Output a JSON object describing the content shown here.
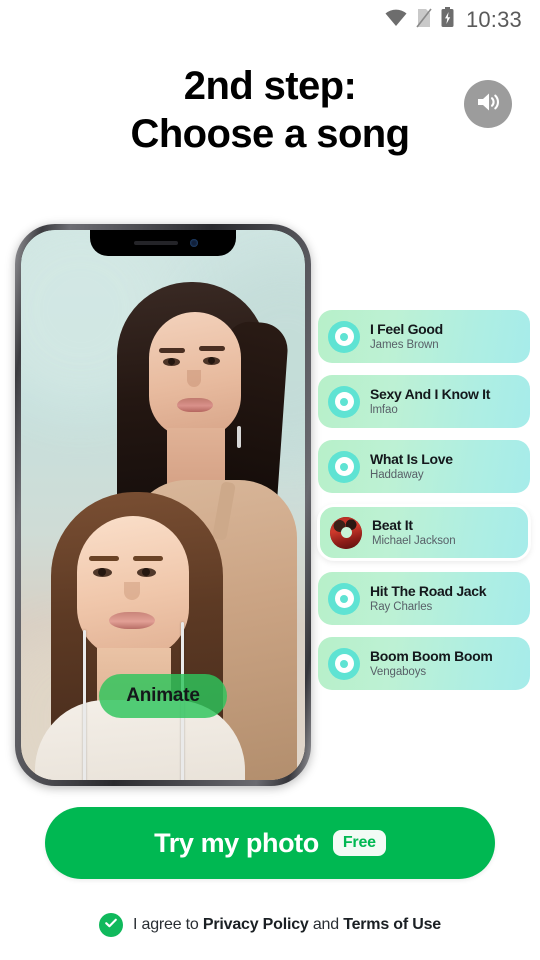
{
  "status_bar": {
    "time": "10:33",
    "icons": [
      "wifi-icon",
      "sim-card-off-icon",
      "battery-charging-icon"
    ]
  },
  "header": {
    "title_line1": "2nd step:",
    "title_line2": "Choose a song",
    "sound_button_icon": "speaker-volume-icon"
  },
  "preview": {
    "animate_button_label": "Animate"
  },
  "songs": [
    {
      "title": "I Feel Good",
      "artist": "James Brown",
      "selected": false,
      "icon": "vinyl-disc-icon"
    },
    {
      "title": "Sexy And I Know It",
      "artist": "lmfao",
      "selected": false,
      "icon": "vinyl-disc-icon"
    },
    {
      "title": "What Is Love",
      "artist": "Haddaway",
      "selected": false,
      "icon": "vinyl-disc-icon"
    },
    {
      "title": "Beat It",
      "artist": "Michael Jackson",
      "selected": true,
      "icon": "album-art-icon"
    },
    {
      "title": "Hit The Road Jack",
      "artist": "Ray Charles",
      "selected": false,
      "icon": "vinyl-disc-icon"
    },
    {
      "title": "Boom Boom Boom",
      "artist": "Vengaboys",
      "selected": false,
      "icon": "vinyl-disc-icon"
    }
  ],
  "cta": {
    "label": "Try my photo",
    "badge": "Free"
  },
  "consent": {
    "prefix": "I agree to ",
    "privacy_link": "Privacy Policy",
    "conjunction": " and ",
    "terms_link": "Terms of Use",
    "checked": true,
    "check_icon": "check-circle-icon"
  },
  "colors": {
    "brand_green": "#00b852",
    "card_gradient_start": "#b7f0c9",
    "card_gradient_end": "#a6ecea",
    "disc_cyan": "#5fe3d3",
    "sound_button_gray": "#9c9c9c",
    "check_green": "#10b95c"
  }
}
